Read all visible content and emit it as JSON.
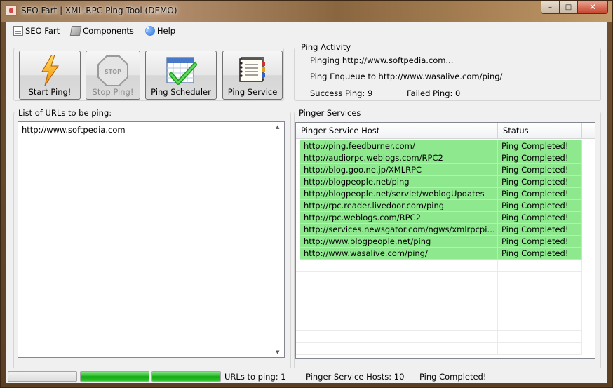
{
  "window": {
    "title": "SEO Fart | XML-RPC Ping Tool (DEMO)",
    "controls": {
      "minimize": "–",
      "maximize": "□",
      "close": "✕"
    }
  },
  "menu": [
    {
      "label": "SEO Fart",
      "icon": "document-icon"
    },
    {
      "label": "Components",
      "icon": "components-icon"
    },
    {
      "label": "Help",
      "icon": "help-icon"
    }
  ],
  "toolbar": {
    "start_label": "Start Ping!",
    "stop_label": "Stop Ping!",
    "stop_sign_text": "STOP",
    "scheduler_label": "Ping Scheduler",
    "service_label": "Ping Service"
  },
  "activity": {
    "title": "Ping Activity",
    "pinging": "Pinging http://www.softpedia.com...",
    "enqueue": "Ping Enqueue to http://www.wasalive.com/ping/",
    "success": "Success Ping: 9",
    "failed": "Failed Ping: 0"
  },
  "urls": {
    "title": "List of URLs to be ping:",
    "items": [
      "http://www.softpedia.com"
    ]
  },
  "pinger": {
    "title": "Pinger Services",
    "columns": [
      "Pinger Service Host",
      "Status"
    ],
    "rows": [
      {
        "host": "http://ping.feedburner.com/",
        "status": "Ping Completed!"
      },
      {
        "host": "http://audiorpc.weblogs.com/RPC2",
        "status": "Ping Completed!"
      },
      {
        "host": "http://blog.goo.ne.jp/XMLRPC",
        "status": "Ping Completed!"
      },
      {
        "host": "http://blogpeople.net/ping",
        "status": "Ping Completed!"
      },
      {
        "host": "http://blogpeople.net/servlet/weblogUpdates",
        "status": "Ping Completed!"
      },
      {
        "host": "http://rpc.reader.livedoor.com/ping",
        "status": "Ping Completed!"
      },
      {
        "host": "http://rpc.weblogs.com/RPC2",
        "status": "Ping Completed!"
      },
      {
        "host": "http://services.newsgator.com/ngws/xmlrpcping.aspx",
        "status": "Ping Completed!"
      },
      {
        "host": "http://www.blogpeople.net/ping",
        "status": "Ping Completed!"
      },
      {
        "host": "http://www.wasalive.com/ping/",
        "status": "Ping Completed!"
      }
    ]
  },
  "status": {
    "progress": [
      0,
      1,
      1
    ],
    "urls_to_ping": "URLs to ping: 1",
    "hosts": "Pinger Service Hosts: 10",
    "state": "Ping Completed!"
  },
  "colors": {
    "row_done": "#8ee88e",
    "progress_green": "#20b820"
  }
}
